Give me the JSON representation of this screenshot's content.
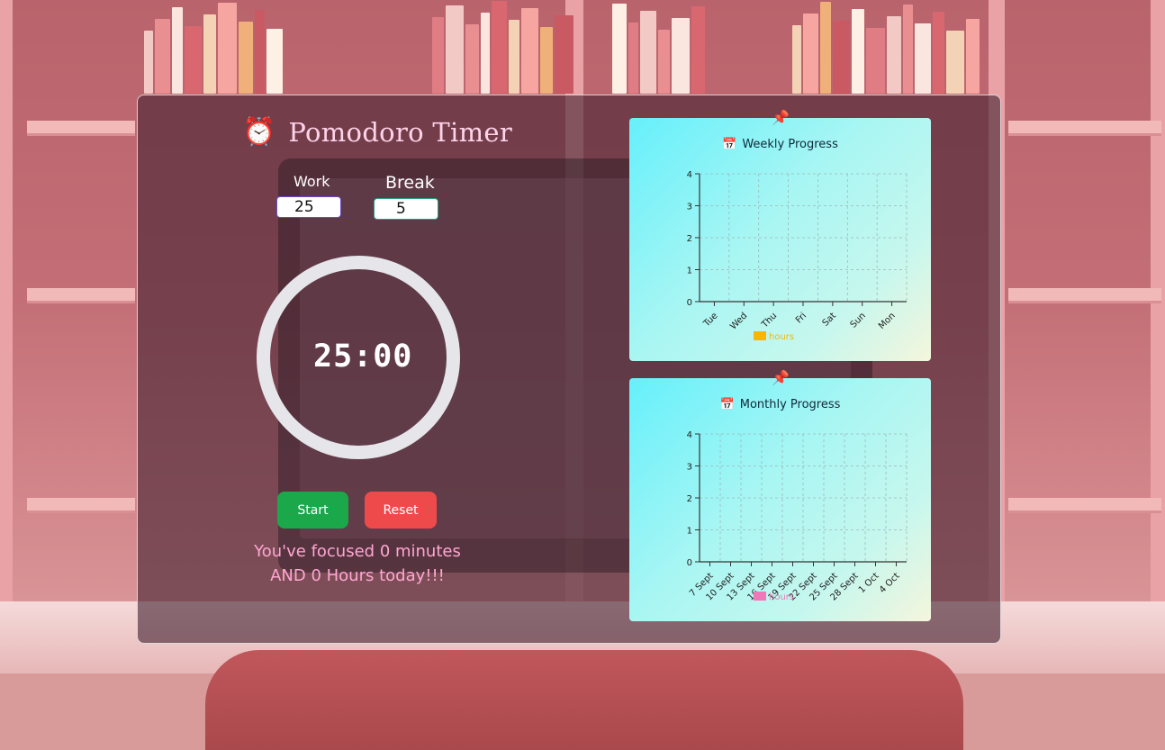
{
  "app": {
    "title": "Pomodoro Timer",
    "title_icon": "alarm-clock-icon"
  },
  "settings": {
    "work_label": "Work",
    "break_label": "Break",
    "work_value": "25",
    "break_value": "5"
  },
  "timer": {
    "display": "25:00"
  },
  "controls": {
    "start_label": "Start",
    "reset_label": "Reset",
    "start_color": "#1aa84a",
    "reset_color": "#ef4a4b"
  },
  "summary": {
    "line1": "You've focused 0 minutes",
    "line2": "AND 0 Hours today!!!"
  },
  "cards": {
    "weekly_title": "Weekly Progress",
    "monthly_title": "Monthly Progress",
    "pin_icon": "pushpin-icon",
    "calendar_icon": "calendar-icon"
  },
  "chart_data": [
    {
      "type": "bar",
      "title": "Weekly Progress",
      "categories": [
        "Tue",
        "Wed",
        "Thu",
        "Fri",
        "Sat",
        "Sun",
        "Mon"
      ],
      "series": [
        {
          "name": "hours",
          "values": [
            0,
            0,
            0,
            0,
            0,
            0,
            0
          ],
          "color": "#f5b800"
        }
      ],
      "ylim": [
        0,
        4
      ],
      "yticks": [
        0,
        1,
        2,
        3,
        4
      ],
      "grid": true,
      "legend": "bottom"
    },
    {
      "type": "bar",
      "title": "Monthly Progress",
      "categories": [
        "7 Sept",
        "10 Sept",
        "13 Sept",
        "16 Sept",
        "19 Sept",
        "22 Sept",
        "25 Sept",
        "28 Sept",
        "1 Oct",
        "4 Oct"
      ],
      "series": [
        {
          "name": "hours",
          "values": [
            0,
            0,
            0,
            0,
            0,
            0,
            0,
            0,
            0,
            0
          ],
          "color": "#f078b8"
        }
      ],
      "ylim": [
        0,
        4
      ],
      "yticks": [
        0,
        1,
        2,
        3,
        4
      ],
      "grid": true,
      "legend": "bottom"
    }
  ]
}
